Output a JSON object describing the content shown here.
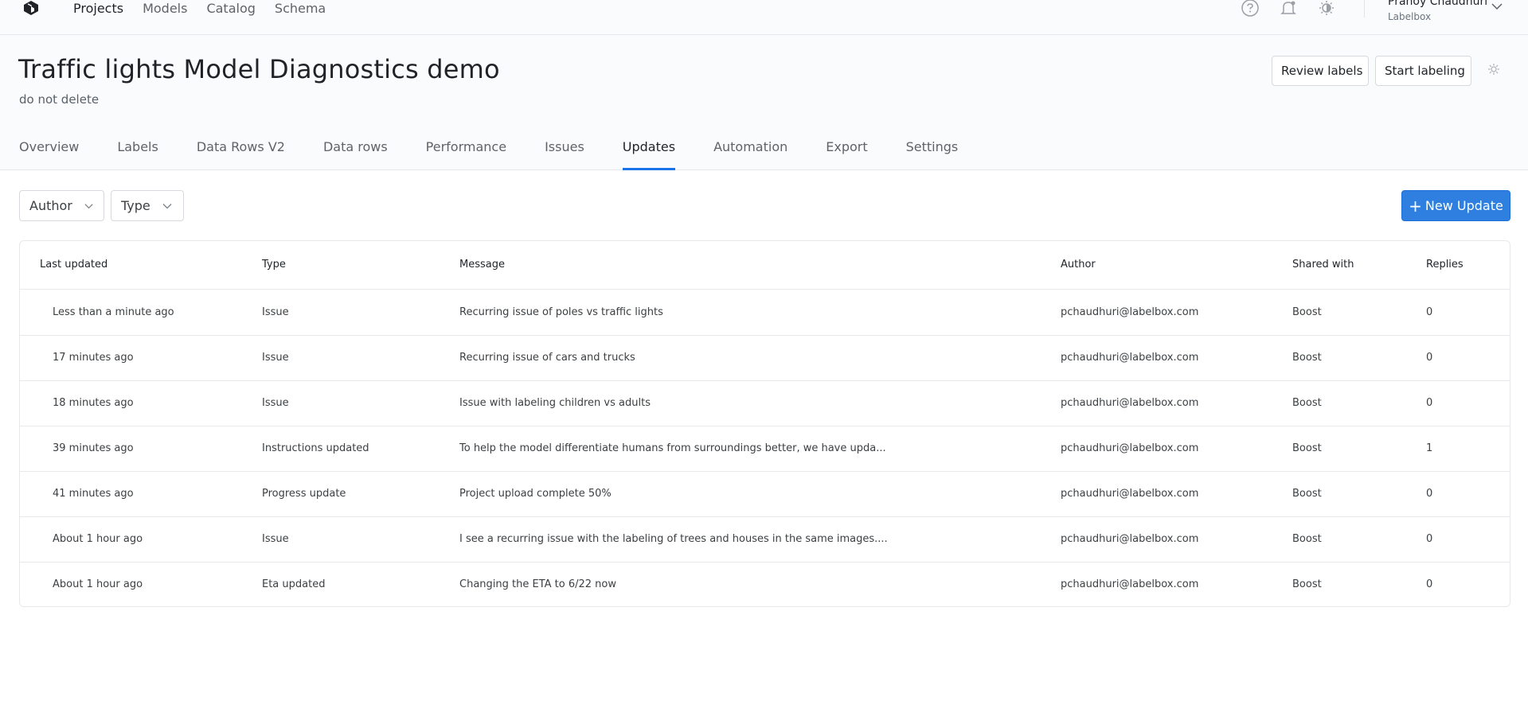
{
  "topnav": {
    "items": [
      "Projects",
      "Models",
      "Catalog",
      "Schema"
    ],
    "active": "Projects"
  },
  "user": {
    "name": "Pranoy Chaudhuri",
    "org": "Labelbox"
  },
  "header": {
    "title": "Traffic lights Model Diagnostics demo",
    "subtitle": "do not delete",
    "review_label": "Review labels",
    "start_label": "Start labeling"
  },
  "tabs": [
    "Overview",
    "Labels",
    "Data Rows V2",
    "Data rows",
    "Performance",
    "Issues",
    "Updates",
    "Automation",
    "Export",
    "Settings"
  ],
  "active_tab": "Updates",
  "filters": {
    "author": "Author",
    "type": "Type"
  },
  "new_update_label": "New Update",
  "accent_color": "#2f7fe1",
  "table": {
    "columns": [
      "Last updated",
      "Type",
      "Message",
      "Author",
      "Shared with",
      "Replies"
    ],
    "rows": [
      [
        "Less than a minute ago",
        "Issue",
        "Recurring issue of poles vs traffic lights",
        "pchaudhuri@labelbox.com",
        "Boost",
        "0"
      ],
      [
        "17 minutes ago",
        "Issue",
        "Recurring issue of cars and trucks",
        "pchaudhuri@labelbox.com",
        "Boost",
        "0"
      ],
      [
        "18 minutes ago",
        "Issue",
        "Issue with labeling children vs adults",
        "pchaudhuri@labelbox.com",
        "Boost",
        "0"
      ],
      [
        "39 minutes ago",
        "Instructions updated",
        "To help the model differentiate humans from surroundings better, we have upda...",
        "pchaudhuri@labelbox.com",
        "Boost",
        "1"
      ],
      [
        "41 minutes ago",
        "Progress update",
        "Project upload complete 50%",
        "pchaudhuri@labelbox.com",
        "Boost",
        "0"
      ],
      [
        "About 1 hour ago",
        "Issue",
        "I see a recurring issue with the labeling of trees and houses in the same images....",
        "pchaudhuri@labelbox.com",
        "Boost",
        "0"
      ],
      [
        "About 1 hour ago",
        "Eta updated",
        "Changing the ETA to 6/22 now",
        "pchaudhuri@labelbox.com",
        "Boost",
        "0"
      ]
    ]
  }
}
